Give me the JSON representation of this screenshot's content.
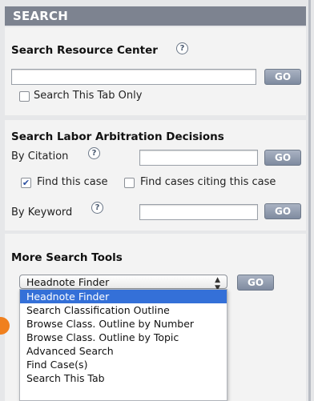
{
  "header": {
    "title": "SEARCH"
  },
  "resource_center": {
    "title": "Search Resource Center",
    "go_label": "GO",
    "checkbox_label": "Search This Tab Only",
    "input_value": ""
  },
  "labor": {
    "title": "Search Labor Arbitration Decisions",
    "by_citation": "By Citation",
    "by_keyword": "By Keyword",
    "go_label": "GO",
    "find_case": "Find this case",
    "find_citing": "Find cases citing this case"
  },
  "tools": {
    "title": "More Search Tools",
    "selected": "Headnote Finder",
    "go_label": "GO",
    "options": [
      "Headnote Finder",
      "Search Classification Outline",
      "Browse Class. Outline by Number",
      "Browse Class. Outline by Topic",
      "Advanced Search",
      "Find Case(s)",
      "Search This Tab"
    ]
  },
  "help_glyph": "?",
  "colors": {
    "header": "#7d8390",
    "highlight": "#3470d8",
    "badge": "#f0801e"
  }
}
